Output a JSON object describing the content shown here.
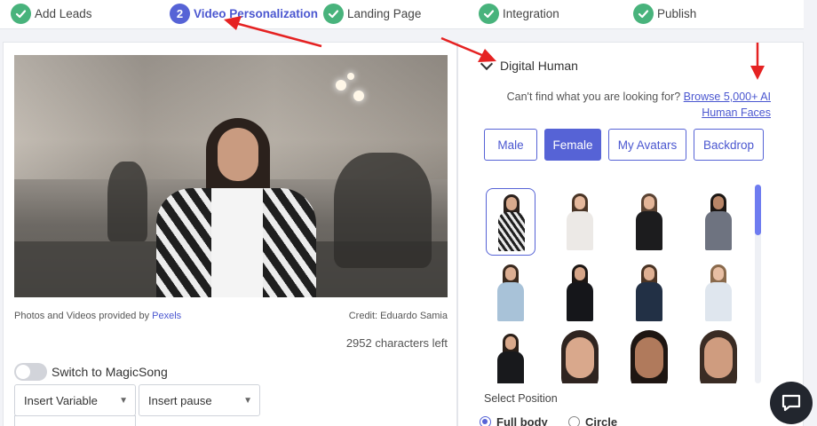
{
  "stepper": {
    "steps": [
      {
        "label": "Add Leads",
        "state": "done"
      },
      {
        "label": "Video Personalization",
        "state": "active",
        "number": "2"
      },
      {
        "label": "Landing Page",
        "state": "done"
      },
      {
        "label": "Integration",
        "state": "done"
      },
      {
        "label": "Publish",
        "state": "done"
      }
    ]
  },
  "left": {
    "credit_prefix": "Photos and Videos provided by ",
    "credit_link": "Pexels",
    "credit_author": "Credit: Eduardo Samia",
    "chars_left": "2952 characters left",
    "toggle_label": "Switch to MagicSong",
    "select_variable": "Insert Variable",
    "select_pause": "Insert pause"
  },
  "right": {
    "section_title": "Digital Human",
    "browse_text": "Can't find what you are looking for?",
    "browse_link_line1": "Browse 5,000+ AI",
    "browse_link_line2": "Human Faces",
    "tabs": [
      {
        "label": "Male",
        "active": false
      },
      {
        "label": "Female",
        "active": true
      },
      {
        "label": "My Avatars",
        "active": false
      },
      {
        "label": "Backdrop",
        "active": false
      }
    ],
    "position_label": "Select Position",
    "position_options": [
      {
        "label": "Full body",
        "selected": true
      },
      {
        "label": "Circle",
        "selected": false
      }
    ]
  },
  "colors": {
    "accent": "#5663d6",
    "done_green": "#48b37c",
    "annotation_red": "#e52222"
  }
}
